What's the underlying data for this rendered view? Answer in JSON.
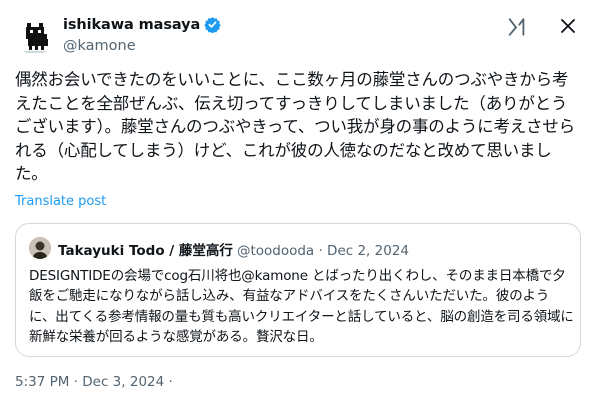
{
  "author": {
    "name": "ishikawa masaya",
    "handle": "@kamone"
  },
  "post": {
    "text": "偶然お会いできたのをいいことに、ここ数ヶ月の藤堂さんのつぶやきから考えたことを全部ぜんぶ、伝え切ってすっきりしてしまいました（ありがとうございます）。藤堂さんのつぶやきって、つい我が身の事のように考えさせられる（心配してしまう）けど、これが彼の人徳なのだなと改めて思いました。",
    "translate_label": "Translate post",
    "timestamp": "5:37 PM · Dec 3, 2024 ·"
  },
  "quote": {
    "name": "Takayuki Todo / 藤堂高行",
    "meta": "@toodooda · Dec 2, 2024",
    "text": "DESIGNTIDEの会場でcog石川将也@kamone とばったり出くわし、そのまま日本橋で夕飯をご馳走になりながら話し込み、有益なアドバイスをたくさんいただいた。彼のように、出てくる参考情報の量も質も高いクリエイターと話していると、脳の創造を司る領域に新鮮な栄養が回るような感覚がある。贅沢な日。"
  },
  "icons": {
    "verified": "verified-badge-icon",
    "brand": "grok-icon",
    "close": "close-icon"
  },
  "colors": {
    "accent": "#1d9bf0",
    "secondary_text": "#536471",
    "border": "#cfd9de"
  }
}
